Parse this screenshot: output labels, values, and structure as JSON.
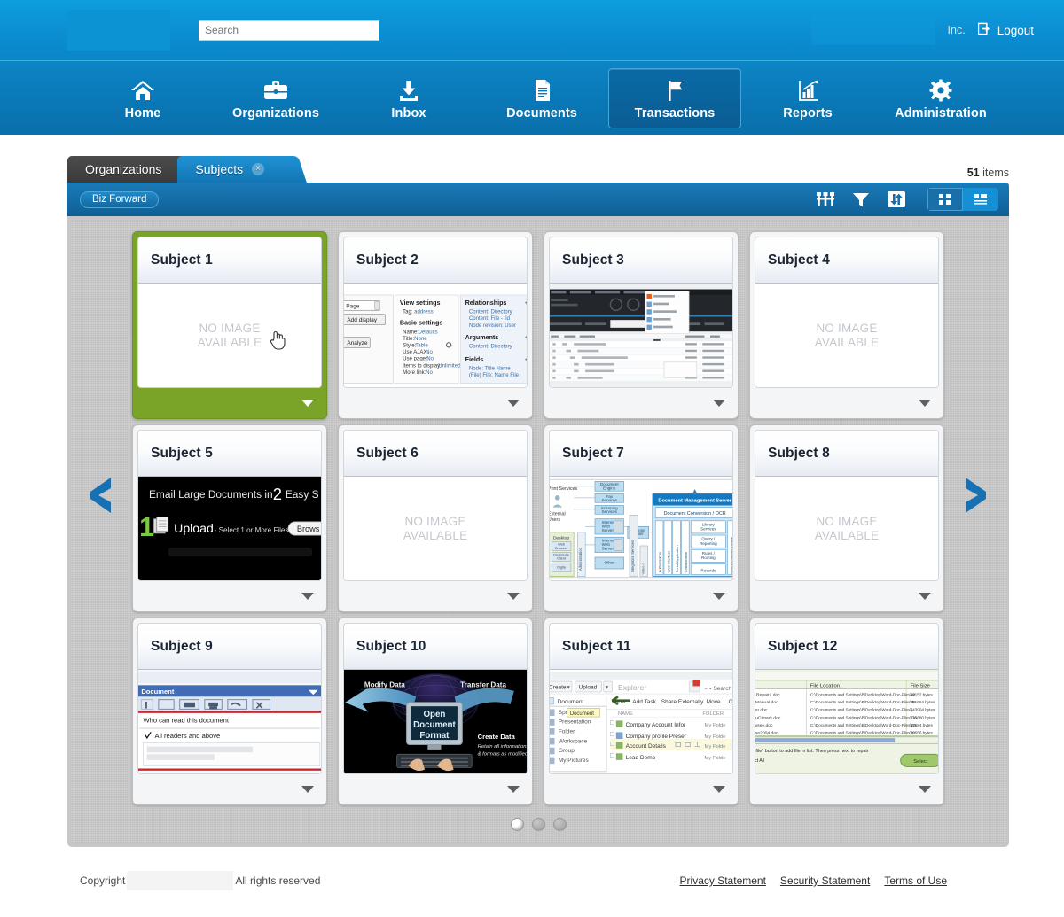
{
  "header": {
    "search_placeholder": "Search",
    "search_value": "",
    "org_name": "Inc.",
    "logout_label": "Logout",
    "logo_alt": "company-logo"
  },
  "nav": {
    "items": [
      {
        "label": "Home",
        "icon": "home-icon",
        "active": false
      },
      {
        "label": "Organizations",
        "icon": "briefcase-icon",
        "active": false
      },
      {
        "label": "Inbox",
        "icon": "inbox-download-icon",
        "active": false
      },
      {
        "label": "Documents",
        "icon": "document-icon",
        "active": false
      },
      {
        "label": "Transactions",
        "icon": "flag-icon",
        "active": true
      },
      {
        "label": "Reports",
        "icon": "chart-icon",
        "active": false
      },
      {
        "label": "Administration",
        "icon": "gear-icon",
        "active": false
      }
    ]
  },
  "tabs": {
    "items": [
      {
        "label": "Organizations",
        "active": false,
        "closable": false
      },
      {
        "label": "Subjects",
        "active": true,
        "closable": true
      }
    ],
    "close_glyph": "×"
  },
  "items_count": {
    "number": "51",
    "label": "items"
  },
  "toolbar": {
    "breadcrumb_pill": "Biz Forward",
    "actions": [
      {
        "name": "group-columns-icon",
        "title": "Group"
      },
      {
        "name": "filter-funnel-icon",
        "title": "Filter"
      },
      {
        "name": "sort-arrows-icon",
        "title": "Sort"
      }
    ],
    "view_grid": {
      "name": "grid-view-icon",
      "active": false
    },
    "view_list": {
      "name": "list-view-icon",
      "active": true
    }
  },
  "cards": [
    {
      "title": "Subject 1",
      "selected": true,
      "thumb": "none",
      "placeholder": "NO IMAGE\nAVAILABLE",
      "placeholder_line1": "NO IMAGE",
      "placeholder_line2": "AVAILABLE"
    },
    {
      "title": "Subject 2",
      "selected": false,
      "thumb": "drupal-views-settings",
      "thumb_text": {
        "select_page": "Page",
        "add_display": "Add display",
        "analyze": "Analyze",
        "view_settings": "View settings",
        "tag": "Tag:  address",
        "basic_settings": "Basic settings",
        "rows": [
          "Name: Defaults",
          "Title: None",
          "Style: Table",
          "Use AJAX: No",
          "Use pager: No",
          "Items to display: Unlimited",
          "More link: No"
        ],
        "relationships": "Relationships",
        "rel_rows": [
          "Content: Directory",
          "Content: File - fid",
          "Node revision: User"
        ],
        "arguments": "Arguments",
        "arg_rows": [
          "Content: Directory"
        ],
        "fields": "Fields",
        "field_rows": [
          "Node: Title Name",
          "(File) File: Name File"
        ]
      }
    },
    {
      "title": "Subject 3",
      "selected": false,
      "thumb": "dark-file-manager"
    },
    {
      "title": "Subject 4",
      "selected": false,
      "thumb": "none",
      "placeholder_line1": "NO IMAGE",
      "placeholder_line2": "AVAILABLE"
    },
    {
      "title": "Subject 5",
      "selected": false,
      "thumb": "email-large-documents",
      "thumb_text": {
        "headline_a": "Email Large Documents in",
        "headline_num": "2",
        "headline_b": "Easy S",
        "step": "1",
        "upload": "Upload",
        "upload_sub": "- Select 1 or More Files",
        "browse": "Brows"
      }
    },
    {
      "title": "Subject 6",
      "selected": false,
      "thumb": "none",
      "placeholder_line1": "NO IMAGE",
      "placeholder_line2": "AVAILABLE"
    },
    {
      "title": "Subject 7",
      "selected": false,
      "thumb": "architecture-diagram",
      "thumb_text": {
        "print_services": "Print Services",
        "external_users": "External Users",
        "desktop": "Desktop",
        "boxes": [
          "Document Engine",
          "Fax Services",
          "Scanning Services",
          "Intranet Web Server",
          "Internet Web Server",
          "Other",
          "Remote Printer"
        ],
        "server": "Document Management Server",
        "conversion": "Document Conversion / OCR",
        "columns": [
          "Authorization",
          "Web Interface",
          "Portal Application",
          "Collaboration",
          "Library Services",
          "Query / Reporting",
          "Rules / Routing",
          "Records",
          "Search Indexing Engine",
          "Integration Services"
        ]
      }
    },
    {
      "title": "Subject 8",
      "selected": false,
      "thumb": "none",
      "placeholder_line1": "NO IMAGE",
      "placeholder_line2": "AVAILABLE"
    },
    {
      "title": "Subject 9",
      "selected": false,
      "thumb": "document-permissions",
      "thumb_text": {
        "panel_title": "Document",
        "question": "Who can read this document",
        "option": "All readers and above"
      }
    },
    {
      "title": "Subject 10",
      "selected": false,
      "thumb": "open-document-format",
      "thumb_text": {
        "modify": "Modify Data",
        "transfer": "Transfer Data",
        "center_l1": "Open",
        "center_l2": "Document",
        "center_l3": "Format",
        "create": "Create Data",
        "create_sub1": "Retain all information",
        "create_sub2": "& formats as modified"
      }
    },
    {
      "title": "Subject 11",
      "selected": false,
      "thumb": "explorer-create-menu",
      "thumb_text": {
        "create": "Create",
        "upload": "Upload",
        "explorer": "Explorer",
        "search": "Search",
        "cols": [
          "NAME",
          "FOLDER"
        ],
        "menu": [
          "Document",
          "Spreadsheet",
          "Presentation",
          "Folder",
          "Workspace",
          "Group",
          "My Pictures"
        ],
        "tooltip": "Document",
        "actions": [
          "Show",
          "Add Task",
          "Share Externally",
          "Move",
          "Co"
        ],
        "rows": [
          "Company Account Infor",
          "Company profile Preser",
          "Account Details",
          "Lead Demo"
        ],
        "folders": [
          "My Folde",
          "My Folde",
          "My Folde",
          "My Folde"
        ]
      }
    },
    {
      "title": "Subject 12",
      "selected": false,
      "thumb": "file-list-table",
      "thumb_text": {
        "cols": [
          "File Location",
          "File Size"
        ],
        "names": [
          "le Repair2.doc",
          "d Manual.doc",
          "hen.doc",
          "BluCtmark.doc",
          "levsee.doc",
          "rtise2004.doc"
        ],
        "paths": [
          "C:\\Documents and Settings\\B\\Desktop\\Word-Doc-Files\\W...",
          "C:\\Documents and Settings\\B\\Desktop\\Word-Doc-Files\\Te...",
          "C:\\Documents and Settings\\B\\Desktop\\Word-Doc-Files\\j...",
          "C:\\Documents and Settings\\B\\Desktop\\Word-Doc-Files\\Do...",
          "C:\\Documents and Settings\\B\\Desktop\\Word-Doc-Files\\pa...",
          "C:\\Documents and Settings\\B\\Desktop\\Word-Doc-Files\\er..."
        ],
        "sizes": [
          "49152 bytes",
          "561664 bytes",
          "443904 bytes",
          "135680 bytes",
          "67584 bytes",
          "70656 bytes"
        ],
        "hint1": "ld file\" button to add file in list. Then press next to repair",
        "hint2": "lect All",
        "button": "Select"
      }
    }
  ],
  "carousel": {
    "prev_icon": "chevron-left-icon",
    "next_icon": "chevron-right-icon",
    "dots": [
      {
        "active": true
      },
      {
        "active": false
      },
      {
        "active": false
      }
    ]
  },
  "footer": {
    "copyright_prefix": "Copyright",
    "rights": "All rights reserved",
    "links": [
      "Privacy Statement",
      "Security Statement",
      "Terms of Use"
    ]
  },
  "colors": {
    "brand_blue": "#0b8ed2",
    "nav_blue": "#0a79b8",
    "toolbar_blue": "#156da7",
    "selected_green": "#79a428",
    "panel_gray": "#c9c9c9"
  }
}
